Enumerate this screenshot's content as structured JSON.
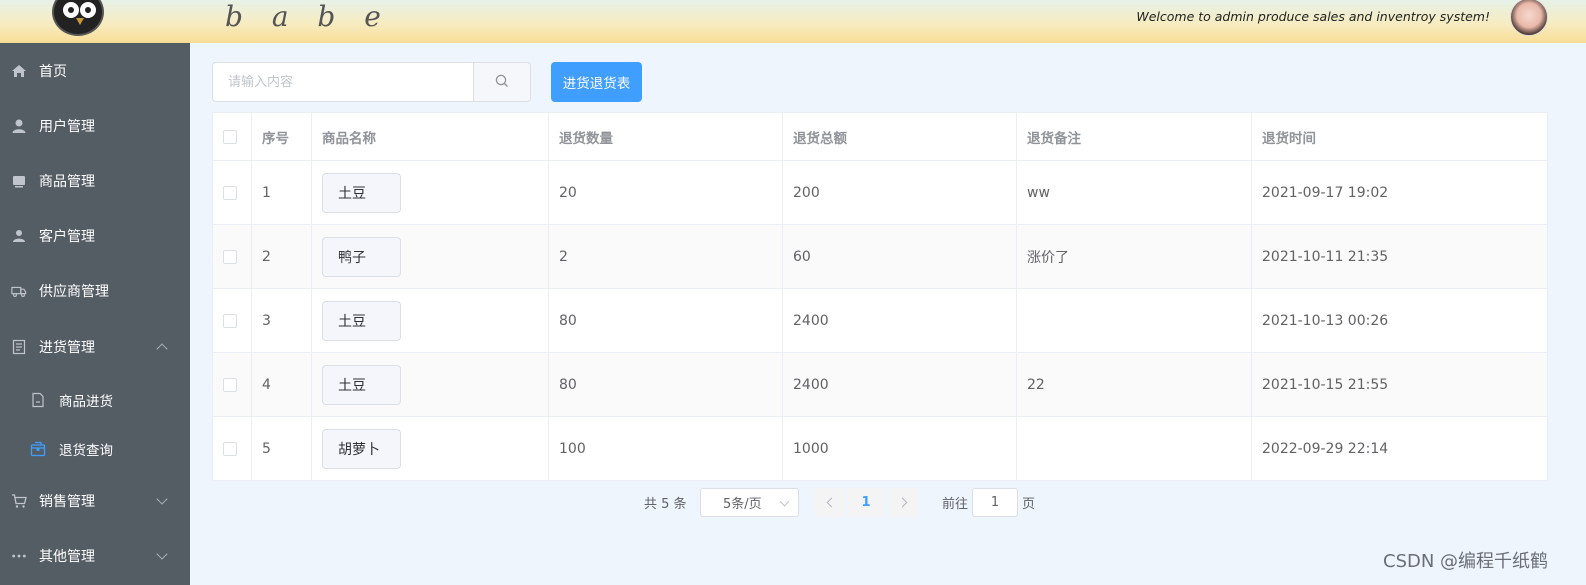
{
  "header": {
    "brand": "b a b e",
    "welcome": "Welcome to admin produce sales and inventroy system!"
  },
  "sidebar": {
    "items": [
      {
        "label": "首页",
        "icon": "home-icon"
      },
      {
        "label": "用户管理",
        "icon": "user-icon"
      },
      {
        "label": "商品管理",
        "icon": "goods-icon"
      },
      {
        "label": "客户管理",
        "icon": "customer-icon"
      },
      {
        "label": "供应商管理",
        "icon": "truck-icon"
      },
      {
        "label": "进货管理",
        "icon": "document-icon",
        "expanded": true
      },
      {
        "label": "商品进货",
        "icon": "file-icon",
        "sub": true
      },
      {
        "label": "退货查询",
        "icon": "box-icon",
        "sub": true,
        "active": true
      },
      {
        "label": "销售管理",
        "icon": "cart-icon",
        "expanded": false
      },
      {
        "label": "其他管理",
        "icon": "more-icon",
        "expanded": false
      }
    ],
    "active_color": "#409eff"
  },
  "search": {
    "placeholder": "请输入内容",
    "value": ""
  },
  "toolbar": {
    "primary_label": "进货退货表"
  },
  "table": {
    "columns": [
      "",
      "序号",
      "商品名称",
      "退货数量",
      "退货总额",
      "退货备注",
      "退货时间"
    ],
    "rows": [
      {
        "index": "1",
        "name": "土豆",
        "qty": "20",
        "total": "200",
        "note": "ww",
        "time": "2021-09-17 19:02"
      },
      {
        "index": "2",
        "name": "鸭子",
        "qty": "2",
        "total": "60",
        "note": "涨价了",
        "time": "2021-10-11 21:35"
      },
      {
        "index": "3",
        "name": "土豆",
        "qty": "80",
        "total": "2400",
        "note": "",
        "time": "2021-10-13 00:26"
      },
      {
        "index": "4",
        "name": "土豆",
        "qty": "80",
        "total": "2400",
        "note": "22",
        "time": "2021-10-15 21:55"
      },
      {
        "index": "5",
        "name": "胡萝卜",
        "qty": "100",
        "total": "1000",
        "note": "",
        "time": "2022-09-29 22:14"
      }
    ]
  },
  "pagination": {
    "total_text": "共 5 条",
    "page_size": "5条/页",
    "current_page": "1",
    "jump_prefix": "前往",
    "jump_value": "1",
    "jump_suffix": "页"
  },
  "watermark": "CSDN @编程千纸鹤",
  "colors": {
    "primary": "#409eff",
    "sidebar": "#545c64",
    "background": "#eef5fd"
  }
}
